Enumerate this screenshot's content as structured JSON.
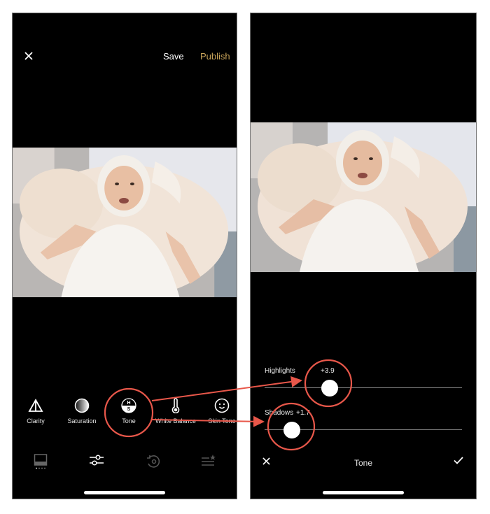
{
  "left_screen": {
    "header": {
      "close_icon": "close-icon",
      "save_label": "Save",
      "publish_label": "Publish",
      "publish_color": "#c9a45a"
    },
    "photo": {
      "description": "Smiling baby in white bonnet lying on cream blanket"
    },
    "tools": [
      {
        "label": "Clarity",
        "icon": "triangle-icon"
      },
      {
        "label": "Saturation",
        "icon": "gradient-circle-icon"
      },
      {
        "label": "Tone",
        "icon": "hs-circle-icon",
        "selected": true
      },
      {
        "label": "White Balance",
        "icon": "thermometer-icon"
      },
      {
        "label": "Skin Tone",
        "icon": "smiley-icon"
      }
    ],
    "tone_icon_text": {
      "top": "H",
      "bottom": "S"
    },
    "bottom_nav": [
      {
        "name": "presets",
        "icon": "presets-icon"
      },
      {
        "name": "adjust",
        "icon": "sliders-icon",
        "active": true
      },
      {
        "name": "history",
        "icon": "history-icon"
      },
      {
        "name": "recipes",
        "icon": "recipes-icon"
      }
    ]
  },
  "right_screen": {
    "photo": {
      "description": "Smiling baby in white bonnet lying on cream blanket"
    },
    "sliders": [
      {
        "label": "Highlights",
        "value_text": "+3.9",
        "position": 0.33
      },
      {
        "label": "Shadows",
        "value_text": "+1.7",
        "position": 0.14
      }
    ],
    "footer": {
      "cancel_icon": "close-icon",
      "title": "Tone",
      "confirm_icon": "check-icon"
    }
  },
  "annotation": {
    "color": "#e8574a"
  }
}
